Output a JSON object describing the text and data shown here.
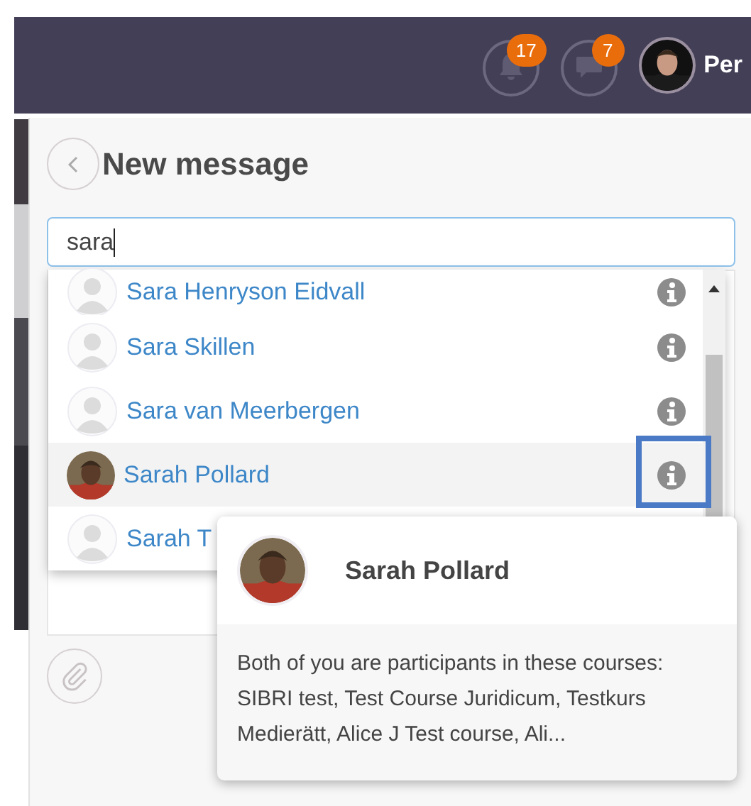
{
  "header": {
    "notifications": {
      "count": "17"
    },
    "messages": {
      "count": "7"
    },
    "user": {
      "name": "Per"
    }
  },
  "panel": {
    "title": "New message",
    "search": {
      "value": "sara"
    },
    "results": [
      {
        "name": "Sara Henryson Eidvall",
        "kind": "placeholder",
        "selected": false,
        "info": true
      },
      {
        "name": "Sara Skillen",
        "kind": "placeholder",
        "selected": false,
        "info": true
      },
      {
        "name": "Sara van Meerbergen",
        "kind": "placeholder",
        "selected": false,
        "info": true
      },
      {
        "name": "Sarah Pollard",
        "selected": true,
        "info": true
      },
      {
        "name": "Sarah T",
        "kind": "placeholder",
        "selected": false,
        "info": false
      }
    ]
  },
  "popover": {
    "name": "Sarah Pollard",
    "text": "Both of you are participants in these courses: SIBRI test, Test Course Juridicum, Testkurs Medierätt, Alice J Test course, Ali..."
  }
}
